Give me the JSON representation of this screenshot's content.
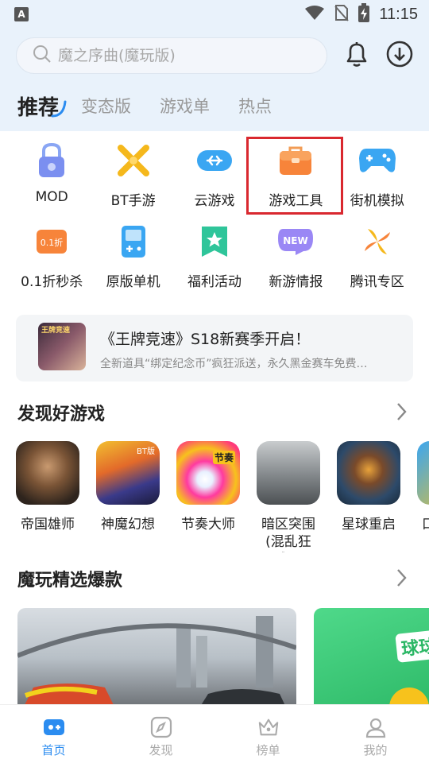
{
  "status_bar": {
    "time": "11:15"
  },
  "search": {
    "placeholder": "魔之序曲(魔玩版)"
  },
  "tabs": [
    {
      "label": "推荐",
      "active": true
    },
    {
      "label": "变态版"
    },
    {
      "label": "游戏单"
    },
    {
      "label": "热点"
    }
  ],
  "categories": [
    {
      "label": "MOD",
      "icon": "lock-icon"
    },
    {
      "label": "BT手游",
      "icon": "crossed-swords-icon"
    },
    {
      "label": "云游戏",
      "icon": "cloud-game-icon"
    },
    {
      "label": "游戏工具",
      "icon": "toolbox-icon",
      "highlighted": true
    },
    {
      "label": "街机模拟",
      "icon": "gamepad-icon"
    },
    {
      "label": "0.1折秒杀",
      "icon": "discount-tag-icon",
      "badge": "0.1折"
    },
    {
      "label": "原版单机",
      "icon": "handheld-icon"
    },
    {
      "label": "福利活动",
      "icon": "star-badge-icon"
    },
    {
      "label": "新游情报",
      "icon": "new-badge-icon",
      "badge": "NEW"
    },
    {
      "label": "腾讯专区",
      "icon": "pinwheel-icon"
    }
  ],
  "banner": {
    "title": "《王牌竞速》S18新赛季开启！",
    "subtitle": "全新道具“绑定纪念币”疯狂派送，永久黑金赛车免费…",
    "thumb_label": "王牌竞速"
  },
  "discover": {
    "title": "发现好游戏",
    "games": [
      {
        "name": "帝国雄师"
      },
      {
        "name": "神魔幻想",
        "badge": "BT版"
      },
      {
        "name": "节奏大师",
        "badge": "节奏"
      },
      {
        "name": "暗区突围\n(混乱狂飙)"
      },
      {
        "name": "星球重启"
      },
      {
        "name": "口"
      }
    ]
  },
  "featured": {
    "title": "魔玩精选爆款",
    "card2_text": "球球"
  },
  "bottom_nav": [
    {
      "label": "首页",
      "icon": "home-icon",
      "active": true
    },
    {
      "label": "发现",
      "icon": "compass-icon"
    },
    {
      "label": "榜单",
      "icon": "crown-icon"
    },
    {
      "label": "我的",
      "icon": "user-icon"
    }
  ],
  "colors": {
    "accent": "#2b8cf0",
    "highlight_border": "#d9282f",
    "top_bg": "#e9f2fb"
  }
}
